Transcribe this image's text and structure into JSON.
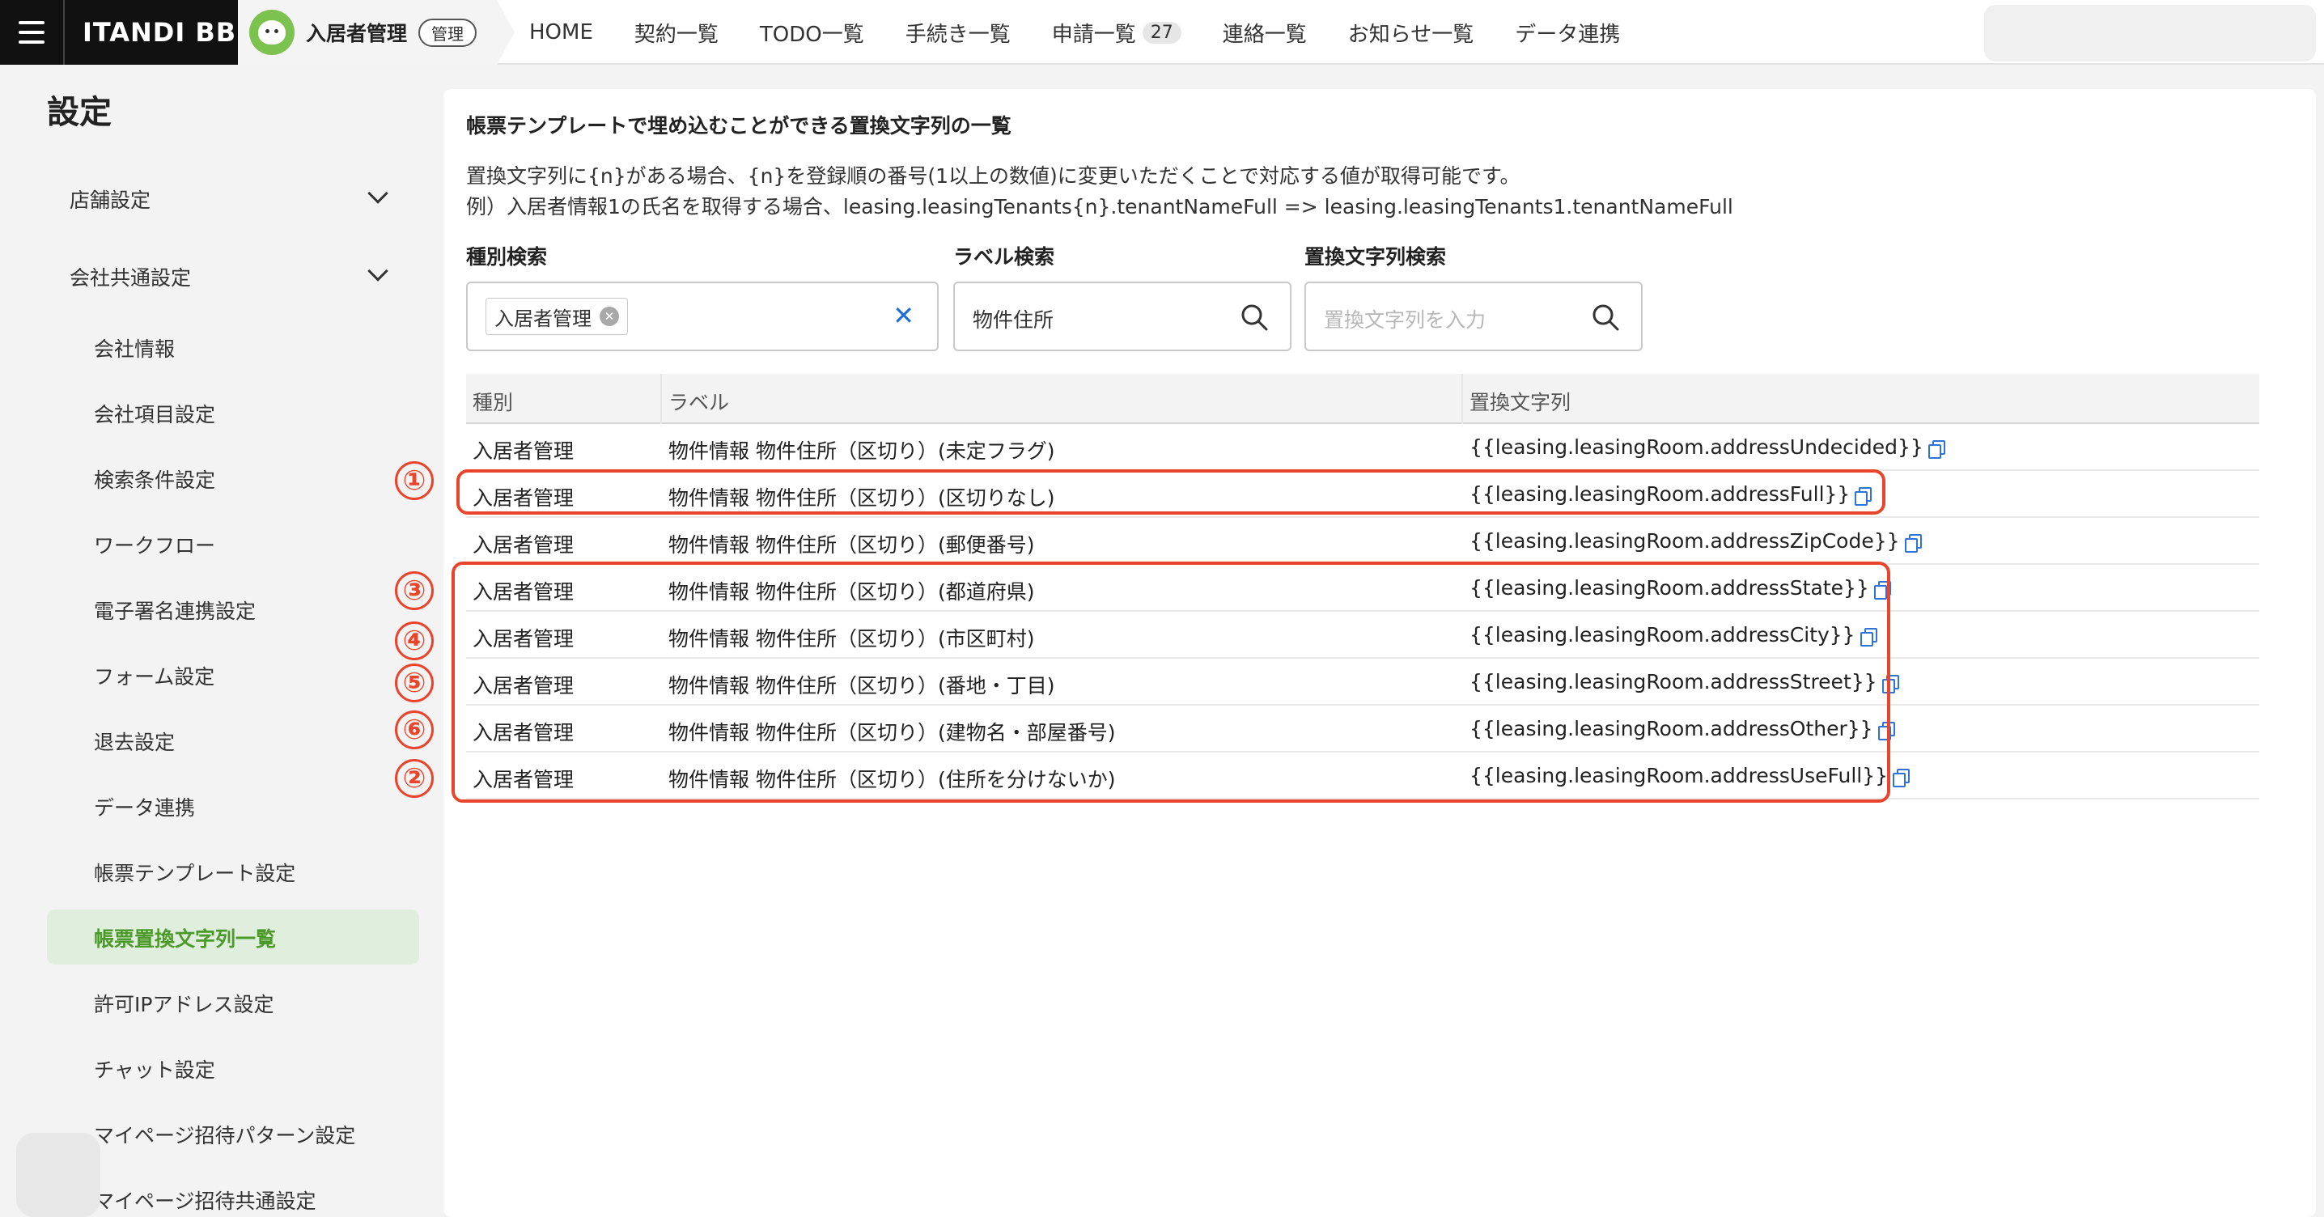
{
  "topbar": {
    "brand": "ITANDI BB",
    "app_name": "入居者管理",
    "app_badge": "管理",
    "nav": [
      {
        "label": "HOME"
      },
      {
        "label": "契約一覧"
      },
      {
        "label": "TODO一覧"
      },
      {
        "label": "手続き一覧"
      },
      {
        "label": "申請一覧",
        "count": "27"
      },
      {
        "label": "連絡一覧"
      },
      {
        "label": "お知らせ一覧"
      },
      {
        "label": "データ連携"
      }
    ]
  },
  "sidebar": {
    "title": "設定",
    "groups": [
      {
        "label": "店舗設定"
      },
      {
        "label": "会社共通設定"
      }
    ],
    "items": [
      {
        "label": "会社情報"
      },
      {
        "label": "会社項目設定"
      },
      {
        "label": "検索条件設定"
      },
      {
        "label": "ワークフロー"
      },
      {
        "label": "電子署名連携設定"
      },
      {
        "label": "フォーム設定"
      },
      {
        "label": "退去設定"
      },
      {
        "label": "データ連携"
      },
      {
        "label": "帳票テンプレート設定"
      },
      {
        "label": "帳票置換文字列一覧"
      },
      {
        "label": "許可IPアドレス設定"
      },
      {
        "label": "チャット設定"
      },
      {
        "label": "マイページ招待パターン設定"
      },
      {
        "label": "マイページ招待共通設定"
      }
    ],
    "active_index": 9
  },
  "main": {
    "heading": "帳票テンプレートで埋め込むことができる置換文字列の一覧",
    "desc_line1": "置換文字列に{n}がある場合、{n}を登録順の番号(1以上の数値)に変更いただくことで対応する値が取得可能です。",
    "desc_line2": "例）入居者情報1の氏名を取得する場合、leasing.leasingTenants{n}.tenantNameFull => leasing.leasingTenants1.tenantNameFull",
    "filters": {
      "type": {
        "label": "種別検索",
        "chip": "入居者管理"
      },
      "label": {
        "label": "ラベル検索",
        "value": "物件住所"
      },
      "replace": {
        "label": "置換文字列検索",
        "placeholder": "置換文字列を入力"
      }
    },
    "table": {
      "headers": [
        "種別",
        "ラベル",
        "置換文字列"
      ],
      "rows": [
        {
          "type": "入居者管理",
          "label": "物件情報 物件住所（区切り）(未定フラグ)",
          "replace": "{{leasing.leasingRoom.addressUndecided}}"
        },
        {
          "type": "入居者管理",
          "label": "物件情報 物件住所（区切り）(区切りなし)",
          "replace": "{{leasing.leasingRoom.addressFull}}"
        },
        {
          "type": "入居者管理",
          "label": "物件情報 物件住所（区切り）(郵便番号)",
          "replace": "{{leasing.leasingRoom.addressZipCode}}"
        },
        {
          "type": "入居者管理",
          "label": "物件情報 物件住所（区切り）(都道府県)",
          "replace": "{{leasing.leasingRoom.addressState}}"
        },
        {
          "type": "入居者管理",
          "label": "物件情報 物件住所（区切り）(市区町村)",
          "replace": "{{leasing.leasingRoom.addressCity}}"
        },
        {
          "type": "入居者管理",
          "label": "物件情報 物件住所（区切り）(番地・丁目)",
          "replace": "{{leasing.leasingRoom.addressStreet}}"
        },
        {
          "type": "入居者管理",
          "label": "物件情報 物件住所（区切り）(建物名・部屋番号)",
          "replace": "{{leasing.leasingRoom.addressOther}}"
        },
        {
          "type": "入居者管理",
          "label": "物件情報 物件住所（区切り）(住所を分けないか)",
          "replace": "{{leasing.leasingRoom.addressUseFull}}"
        }
      ]
    },
    "annotations": [
      "①",
      "③",
      "④",
      "⑤",
      "⑥",
      "②"
    ],
    "annotation_color": "#e8452c"
  }
}
